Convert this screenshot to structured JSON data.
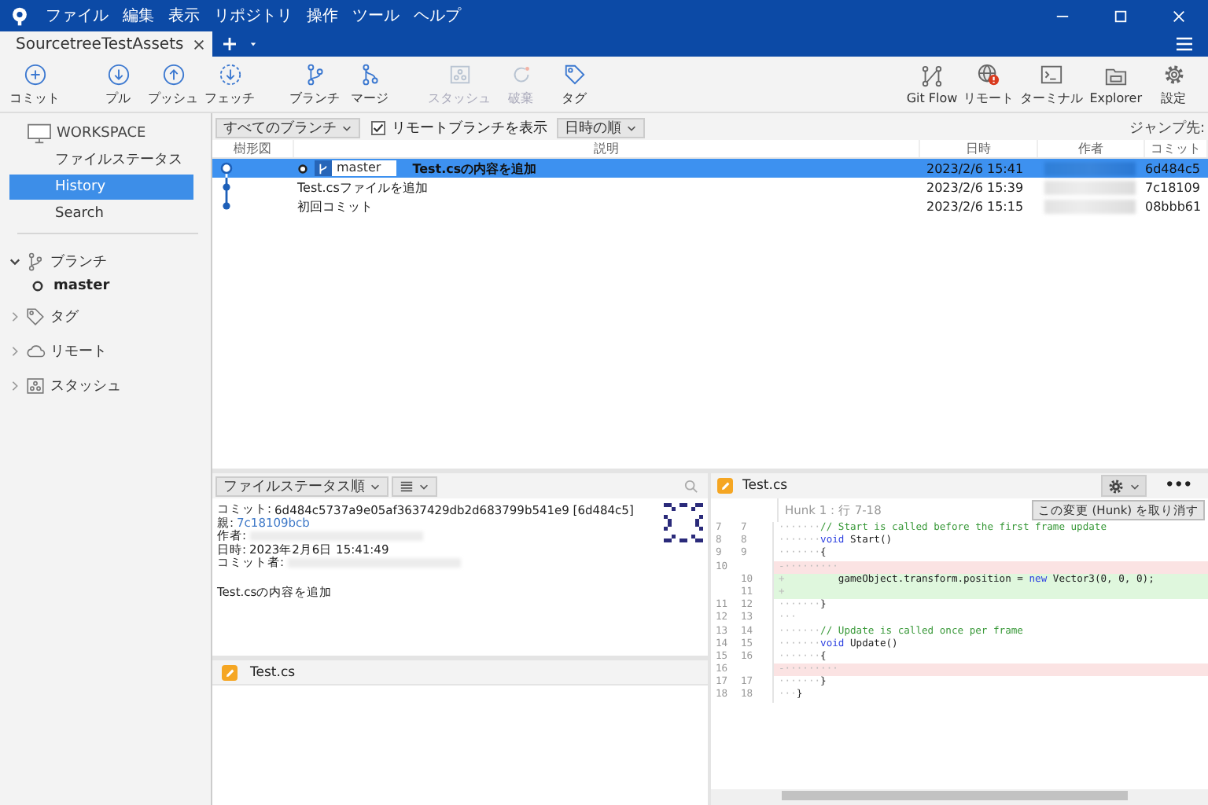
{
  "menu": [
    "ファイル",
    "編集",
    "表示",
    "リポジトリ",
    "操作",
    "ツール",
    "ヘルプ"
  ],
  "tabs": [
    {
      "label": "SourcetreeTestAssets",
      "selected": true
    }
  ],
  "toolbar": {
    "groups": [
      [
        {
          "label": "コミット",
          "kind": "commit",
          "disabled": false
        }
      ],
      [
        {
          "label": "プル",
          "kind": "pull",
          "disabled": false
        },
        {
          "label": "プッシュ",
          "kind": "push",
          "disabled": false
        },
        {
          "label": "フェッチ",
          "kind": "fetch",
          "disabled": false
        }
      ],
      [
        {
          "label": "ブランチ",
          "kind": "branch",
          "disabled": false
        },
        {
          "label": "マージ",
          "kind": "merge",
          "disabled": false
        }
      ],
      [
        {
          "label": "スタッシュ",
          "kind": "stash",
          "disabled": true
        },
        {
          "label": "破棄",
          "kind": "discard",
          "disabled": true
        },
        {
          "label": "タグ",
          "kind": "tag",
          "disabled": false
        }
      ]
    ],
    "right": [
      {
        "label": "Git Flow",
        "kind": "gitflow",
        "disabled": false
      },
      {
        "label": "リモート",
        "kind": "remote",
        "disabled": false
      },
      {
        "label": "ターミナル",
        "kind": "terminal",
        "disabled": false
      },
      {
        "label": "Explorer",
        "kind": "explorer",
        "disabled": false
      },
      {
        "label": "設定",
        "kind": "settings",
        "disabled": false
      }
    ]
  },
  "sidebar": {
    "workspace": {
      "title": "WORKSPACE",
      "items": [
        {
          "label": "ファイルステータス",
          "selected": false
        },
        {
          "label": "History",
          "selected": true
        },
        {
          "label": "Search",
          "selected": false
        }
      ]
    },
    "sections": [
      {
        "label": "ブランチ",
        "kind": "branch",
        "expanded": true,
        "children": [
          {
            "label": "master",
            "current": true
          }
        ]
      },
      {
        "label": "タグ",
        "kind": "tag",
        "expanded": false
      },
      {
        "label": "リモート",
        "kind": "remote",
        "expanded": false
      },
      {
        "label": "スタッシュ",
        "kind": "stash",
        "expanded": false
      }
    ]
  },
  "history": {
    "branches": "すべてのブランチ",
    "show_remote": {
      "label": "リモートブランチを表示",
      "checked": true
    },
    "order": "日時の順",
    "jump": "ジャンプ先:",
    "columns": [
      "樹形図",
      "説明",
      "日時",
      "作者",
      "コミット"
    ],
    "rows": [
      {
        "head": true,
        "branch": "master",
        "description": "Test.csの内容を追加",
        "date": "2023/2/6  15:41",
        "hash": "6d484c5",
        "selected": true
      },
      {
        "head": false,
        "description": "Test.csファイルを追加",
        "date": "2023/2/6  15:39",
        "hash": "7c18109",
        "selected": false
      },
      {
        "head": false,
        "description": "初回コミット",
        "date": "2023/2/6  15:15",
        "hash": "08bbb61",
        "selected": false
      }
    ]
  },
  "details": {
    "sort": "ファイルステータス順",
    "fields": [
      {
        "label": "コミット:",
        "value": "6d484c5737a9e05af3637429db2d683799b541e9 [6d484c5]",
        "kind": "text"
      },
      {
        "label": "親:",
        "value": "7c18109bcb",
        "kind": "link"
      },
      {
        "label": "作者:",
        "kind": "blurred"
      },
      {
        "label": "日時:",
        "value": "2023年2月6日 15:41:49",
        "kind": "text"
      },
      {
        "label": "コミット者:",
        "kind": "blurred"
      }
    ],
    "message": "Test.csの内容を追加",
    "files": [
      {
        "name": "Test.cs"
      }
    ]
  },
  "diff": {
    "file": "Test.cs",
    "more": "•••",
    "hunk": "Hunk 1 : 行 7-18",
    "discard": "この変更 (Hunk) を取り消す",
    "lines": [
      {
        "old": "7",
        "new": "7",
        "kind": "context",
        "tokens": [
          {
            "t": "·······",
            "kind": "ws"
          },
          {
            "t": "// Start is called before the first frame update",
            "kind": "comment"
          }
        ]
      },
      {
        "old": "8",
        "new": "8",
        "kind": "context",
        "tokens": [
          {
            "t": "·······",
            "kind": "ws"
          },
          {
            "t": "void",
            "kind": "keyword"
          },
          {
            "t": " Start()",
            "kind": "plain"
          }
        ]
      },
      {
        "old": "9",
        "new": "9",
        "kind": "context",
        "tokens": [
          {
            "t": "·······",
            "kind": "ws"
          },
          {
            "t": "{",
            "kind": "plain"
          }
        ]
      },
      {
        "old": "10",
        "kind": "removed",
        "tokens": [
          {
            "t": "-·········",
            "kind": "ws"
          }
        ]
      },
      {
        "new": "10",
        "kind": "added",
        "tokens": [
          {
            "t": "+         ",
            "kind": "ws"
          },
          {
            "t": "gameObject.transform.position = ",
            "kind": "plain"
          },
          {
            "t": "new",
            "kind": "keyword"
          },
          {
            "t": " Vector3(0, 0, 0);",
            "kind": "plain"
          }
        ]
      },
      {
        "new": "11",
        "kind": "added",
        "tokens": [
          {
            "t": "+",
            "kind": "ws"
          }
        ]
      },
      {
        "old": "11",
        "new": "12",
        "kind": "context",
        "tokens": [
          {
            "t": "·······",
            "kind": "ws"
          },
          {
            "t": "}",
            "kind": "plain"
          }
        ]
      },
      {
        "old": "12",
        "new": "13",
        "kind": "context",
        "tokens": [
          {
            "t": "···",
            "kind": "ws"
          }
        ]
      },
      {
        "old": "13",
        "new": "14",
        "kind": "context",
        "tokens": [
          {
            "t": "·······",
            "kind": "ws"
          },
          {
            "t": "// Update is called once per frame",
            "kind": "comment"
          }
        ]
      },
      {
        "old": "14",
        "new": "15",
        "kind": "context",
        "tokens": [
          {
            "t": "·······",
            "kind": "ws"
          },
          {
            "t": "void",
            "kind": "keyword"
          },
          {
            "t": " Update()",
            "kind": "plain"
          }
        ]
      },
      {
        "old": "15",
        "new": "16",
        "kind": "context",
        "tokens": [
          {
            "t": "·······",
            "kind": "ws"
          },
          {
            "t": "{",
            "kind": "plain"
          }
        ]
      },
      {
        "old": "16",
        "kind": "removed",
        "tokens": [
          {
            "t": "-·········",
            "kind": "ws"
          }
        ]
      },
      {
        "old": "17",
        "new": "17",
        "kind": "context",
        "tokens": [
          {
            "t": "·······",
            "kind": "ws"
          },
          {
            "t": "}",
            "kind": "plain"
          }
        ]
      },
      {
        "old": "18",
        "new": "18",
        "kind": "context",
        "tokens": [
          {
            "t": "···",
            "kind": "ws"
          },
          {
            "t": "}",
            "kind": "plain"
          }
        ]
      }
    ]
  }
}
